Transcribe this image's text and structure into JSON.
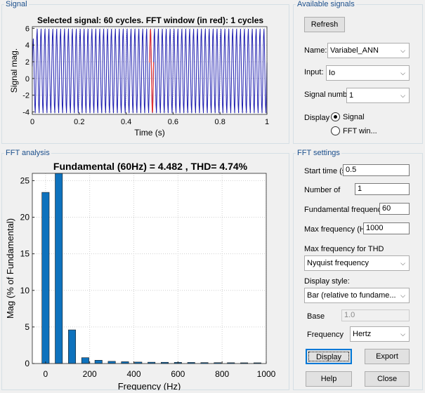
{
  "signal_panel": {
    "title": "Signal",
    "plot_title": "Selected signal: 60 cycles. FFT window (in red): 1 cycles",
    "xlabel": "Time (s)",
    "ylabel": "Signal mag.",
    "x_ticks": [
      "0",
      "0.2",
      "0.4",
      "0.6",
      "0.8",
      "1"
    ],
    "y_ticks": [
      "6",
      "4",
      "2",
      "0",
      "-2",
      "-4"
    ],
    "colors": {
      "signal": "#1f1fb0",
      "fft_window": "#e03030"
    }
  },
  "available_signals": {
    "title": "Available signals",
    "refresh_label": "Refresh",
    "name_label": "Name:",
    "name_value": "Variabel_ANN",
    "input_label": "Input:",
    "input_value": "Io",
    "signal_number_label": "Signal numb",
    "signal_number_value": "1",
    "display_label": "Display",
    "display_signal_label": "Signal",
    "display_fft_label": "FFT win...",
    "display_selected": "Signal"
  },
  "fft_analysis": {
    "title": "FFT analysis",
    "plot_title": "Fundamental (60Hz) = 4.482 , THD= 4.74%",
    "xlabel": "Frequency (Hz)",
    "ylabel": "Mag (% of Fundamental)",
    "x_ticks": [
      "0",
      "200",
      "400",
      "600",
      "800",
      "1000"
    ],
    "y_ticks": [
      "25",
      "20",
      "15",
      "10",
      "5",
      "0"
    ]
  },
  "fft_settings": {
    "title": "FFT settings",
    "start_time_label": "Start time (s",
    "start_time_value": "0.5",
    "num_cycles_label": "Number of",
    "num_cycles_value": "1",
    "fundamental_label": "Fundamental frequenc",
    "fundamental_value": "60",
    "max_freq_label": "Max frequency (H",
    "max_freq_value": "1000",
    "max_freq_thd_label": "Max frequency for THD",
    "max_freq_thd_value": "Nyquist frequency",
    "display_style_label": "Display style:",
    "display_style_value": "Bar (relative to fundame...",
    "base_label": "Base",
    "base_value": "1.0",
    "frequency_label": "Frequency",
    "frequency_value": "Hertz",
    "display_button": "Display",
    "export_button": "Export",
    "help_button": "Help",
    "close_button": "Close"
  },
  "chart_data": [
    {
      "type": "line",
      "title": "Selected signal: 60 cycles. FFT window (in red): 1 cycles",
      "xlabel": "Time (s)",
      "ylabel": "Signal mag.",
      "xlim": [
        0,
        1
      ],
      "ylim": [
        -4.3,
        6.2
      ],
      "cycles": 60,
      "fft_window": [
        0.5,
        0.5167
      ],
      "grid": true,
      "series": [
        {
          "name": "Signal",
          "color": "#1f1fb0"
        },
        {
          "name": "FFT window",
          "color": "#e03030"
        }
      ]
    },
    {
      "type": "bar",
      "title": "Fundamental (60Hz) = 4.482 , THD= 4.74%",
      "xlabel": "Frequency (Hz)",
      "ylabel": "Mag (% of Fundamental)",
      "xlim": [
        -60,
        1000
      ],
      "ylim": [
        0,
        26
      ],
      "grid": true,
      "bar_color": "#0e72bd",
      "x": [
        0,
        60,
        120,
        180,
        240,
        300,
        360,
        420,
        480,
        540,
        600,
        660,
        720,
        780,
        840,
        900,
        960
      ],
      "values": [
        23.4,
        26,
        4.6,
        0.8,
        0.45,
        0.3,
        0.25,
        0.2,
        0.18,
        0.17,
        0.16,
        0.15,
        0.13,
        0.12,
        0.11,
        0.1,
        0.1
      ]
    }
  ]
}
